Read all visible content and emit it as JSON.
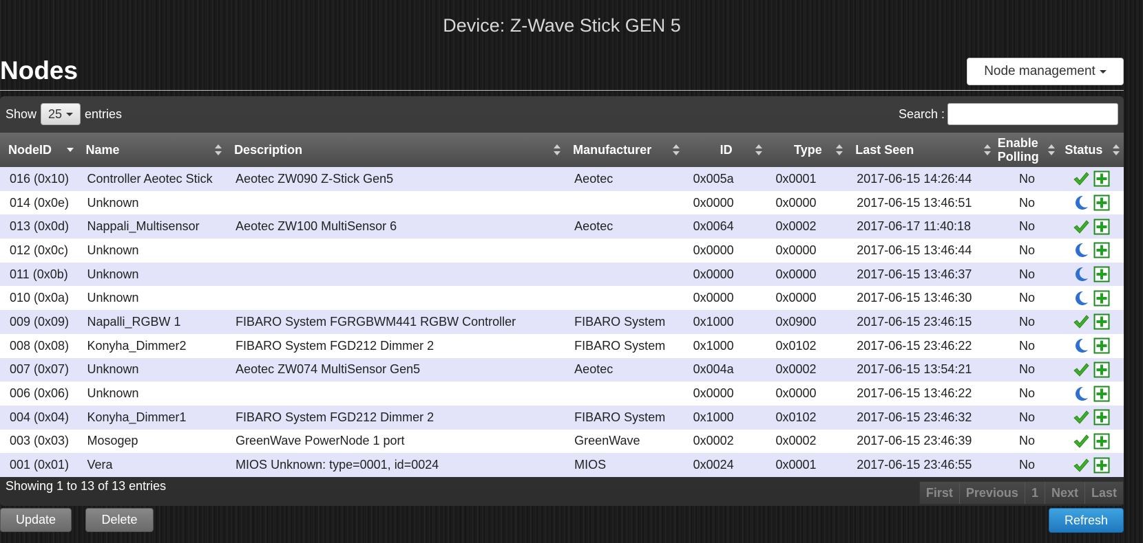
{
  "header": {
    "device_title": "Device: Z-Wave Stick GEN 5",
    "section_title": "Nodes",
    "node_management_label": "Node management"
  },
  "table_controls": {
    "show_label": "Show",
    "page_length": "25",
    "entries_label": "entries",
    "search_label": "Search :",
    "search_value": ""
  },
  "columns": {
    "node_id": "NodeID",
    "name": "Name",
    "description": "Description",
    "manufacturer": "Manufacturer",
    "id": "ID",
    "type": "Type",
    "last_seen": "Last Seen",
    "enable_polling": "Enable Polling",
    "status": "Status"
  },
  "rows": [
    {
      "node_id": "016 (0x10)",
      "name": "Controller Aeotec Stick",
      "description": "Aeotec ZW090 Z-Stick Gen5",
      "manufacturer": "Aeotec",
      "id": "0x005a",
      "type": "0x0001",
      "last_seen": "2017-06-15 14:26:44",
      "polling": "No",
      "status": "awake"
    },
    {
      "node_id": "014 (0x0e)",
      "name": "Unknown",
      "description": "",
      "manufacturer": "",
      "id": "0x0000",
      "type": "0x0000",
      "last_seen": "2017-06-15 13:46:51",
      "polling": "No",
      "status": "sleeping"
    },
    {
      "node_id": "013 (0x0d)",
      "name": "Nappali_Multisensor",
      "description": "Aeotec ZW100 MultiSensor 6",
      "manufacturer": "Aeotec",
      "id": "0x0064",
      "type": "0x0002",
      "last_seen": "2017-06-17 11:40:18",
      "polling": "No",
      "status": "awake"
    },
    {
      "node_id": "012 (0x0c)",
      "name": "Unknown",
      "description": "",
      "manufacturer": "",
      "id": "0x0000",
      "type": "0x0000",
      "last_seen": "2017-06-15 13:46:44",
      "polling": "No",
      "status": "sleeping"
    },
    {
      "node_id": "011 (0x0b)",
      "name": "Unknown",
      "description": "",
      "manufacturer": "",
      "id": "0x0000",
      "type": "0x0000",
      "last_seen": "2017-06-15 13:46:37",
      "polling": "No",
      "status": "sleeping"
    },
    {
      "node_id": "010 (0x0a)",
      "name": "Unknown",
      "description": "",
      "manufacturer": "",
      "id": "0x0000",
      "type": "0x0000",
      "last_seen": "2017-06-15 13:46:30",
      "polling": "No",
      "status": "sleeping"
    },
    {
      "node_id": "009 (0x09)",
      "name": "Napalli_RGBW 1",
      "description": "FIBARO System FGRGBWM441 RGBW Controller",
      "manufacturer": "FIBARO System",
      "id": "0x1000",
      "type": "0x0900",
      "last_seen": "2017-06-15 23:46:15",
      "polling": "No",
      "status": "awake"
    },
    {
      "node_id": "008 (0x08)",
      "name": "Konyha_Dimmer2",
      "description": "FIBARO System FGD212 Dimmer 2",
      "manufacturer": "FIBARO System",
      "id": "0x1000",
      "type": "0x0102",
      "last_seen": "2017-06-15 23:46:22",
      "polling": "No",
      "status": "sleeping"
    },
    {
      "node_id": "007 (0x07)",
      "name": "Unknown",
      "description": "Aeotec ZW074 MultiSensor Gen5",
      "manufacturer": "Aeotec",
      "id": "0x004a",
      "type": "0x0002",
      "last_seen": "2017-06-15 13:54:21",
      "polling": "No",
      "status": "awake"
    },
    {
      "node_id": "006 (0x06)",
      "name": "Unknown",
      "description": "",
      "manufacturer": "",
      "id": "0x0000",
      "type": "0x0000",
      "last_seen": "2017-06-15 13:46:22",
      "polling": "No",
      "status": "sleeping"
    },
    {
      "node_id": "004 (0x04)",
      "name": "Konyha_Dimmer1",
      "description": "FIBARO System FGD212 Dimmer 2",
      "manufacturer": "FIBARO System",
      "id": "0x1000",
      "type": "0x0102",
      "last_seen": "2017-06-15 23:46:32",
      "polling": "No",
      "status": "awake"
    },
    {
      "node_id": "003 (0x03)",
      "name": "Mosogep",
      "description": "GreenWave PowerNode 1 port",
      "manufacturer": "GreenWave",
      "id": "0x0002",
      "type": "0x0002",
      "last_seen": "2017-06-15 23:46:39",
      "polling": "No",
      "status": "awake"
    },
    {
      "node_id": "001 (0x01)",
      "name": "Vera",
      "description": "MIOS Unknown: type=0001, id=0024",
      "manufacturer": "MIOS",
      "id": "0x0024",
      "type": "0x0001",
      "last_seen": "2017-06-15 23:46:55",
      "polling": "No",
      "status": "awake"
    }
  ],
  "icons": {
    "awake": "checkmark-icon",
    "sleeping": "moon-icon",
    "request": "plus-icon"
  },
  "colors": {
    "checkmark": "#3fae29",
    "moon": "#2f6fd0",
    "plus_border": "#1e8a1e",
    "row_odd": "#e3e4fa",
    "row_even": "#ffffff",
    "refresh_button": "#2a8ad0"
  },
  "footer": {
    "info": "Showing 1 to 13 of 13 entries",
    "pager": {
      "first": "First",
      "previous": "Previous",
      "page": "1",
      "next": "Next",
      "last": "Last"
    }
  },
  "buttons": {
    "update": "Update",
    "delete": "Delete",
    "refresh": "Refresh"
  }
}
